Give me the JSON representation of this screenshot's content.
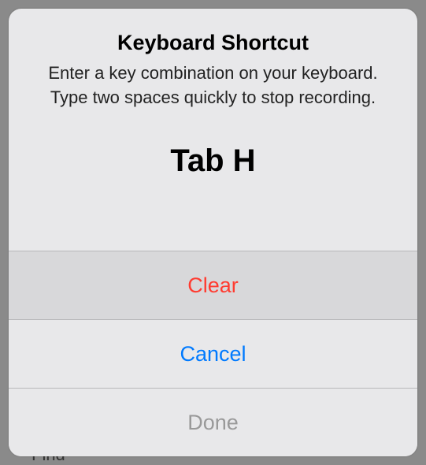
{
  "alert": {
    "title": "Keyboard Shortcut",
    "message": "Enter a key combination on your keyboard. Type two spaces quickly to stop recording.",
    "shortcut_value": "Tab H",
    "buttons": {
      "clear": "Clear",
      "cancel": "Cancel",
      "done": "Done"
    }
  },
  "backdrop": {
    "partial_text": "Find"
  }
}
